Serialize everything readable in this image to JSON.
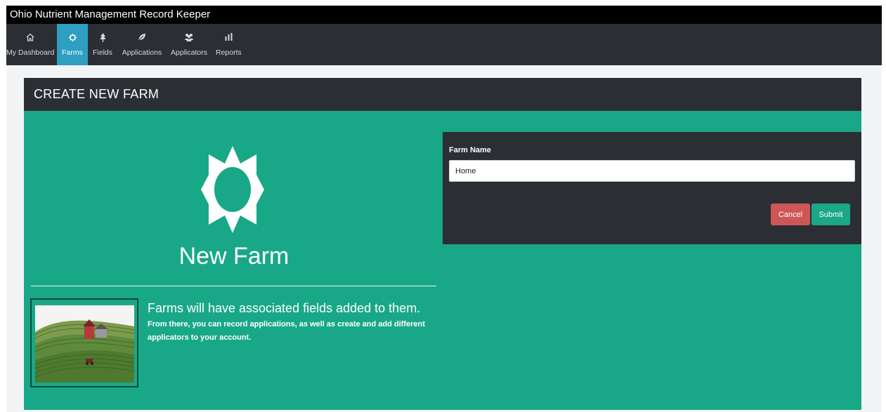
{
  "app": {
    "title": "Ohio Nutrient Management Record Keeper"
  },
  "nav": {
    "items": [
      {
        "label": "My Dashboard",
        "icon": "home-icon"
      },
      {
        "label": "Farms",
        "icon": "sun-icon",
        "active": true
      },
      {
        "label": "Fields",
        "icon": "tree-icon"
      },
      {
        "label": "Applications",
        "icon": "leaf-icon"
      },
      {
        "label": "Applicators",
        "icon": "users-icon"
      },
      {
        "label": "Reports",
        "icon": "bar-chart-icon"
      }
    ]
  },
  "panel": {
    "header": "CREATE NEW FARM"
  },
  "hero": {
    "title": "New Farm",
    "icon": "sun-icon",
    "info_heading": "Farms will have associated fields added to them.",
    "info_text": "From there, you can record applications, as well as create and add different applicators to your account.",
    "image": "farm-illustration"
  },
  "form": {
    "farm_name_label": "Farm Name",
    "farm_name_value": "Home",
    "cancel_label": "Cancel",
    "submit_label": "Submit"
  },
  "colors": {
    "accent": "#19a887",
    "dark": "#2b2f34",
    "active_nav": "#2f9fc1",
    "cancel": "#cf5656"
  }
}
